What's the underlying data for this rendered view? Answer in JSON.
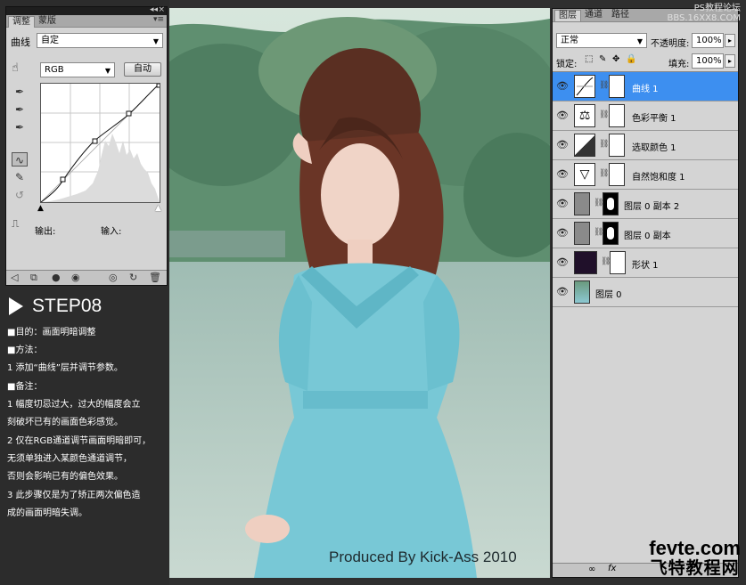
{
  "adjustments": {
    "tabs": [
      "调整",
      "蒙版"
    ],
    "preset_label": "曲线",
    "preset_value": "自定",
    "channel_value": "RGB",
    "auto_label": "自动",
    "output_label": "输出:",
    "input_label": "输入:"
  },
  "instructions": {
    "step_title": "STEP08",
    "lines": [
      "■目的：画面明暗调整",
      "■方法：",
      "1 添加“曲线”层并调节参数。",
      "■备注：",
      "1 幅度切忌过大，过大的幅度会立",
      "  刻破坏已有的画面色彩感觉。",
      "2 仅在RGB通道调节画面明暗即可，",
      "  无须单独进入某颜色通道调节，",
      "  否则会影响已有的偏色效果。",
      "3 此步骤仅是为了矫正两次偏色造",
      "  成的画面明暗失调。"
    ]
  },
  "photo": {
    "credit": "Produced By Kick-Ass 2010"
  },
  "layers_panel": {
    "tabs": [
      "图层",
      "通道",
      "路径"
    ],
    "blend_mode": "正常",
    "opacity_label": "不透明度:",
    "opacity_value": "100%",
    "lock_label": "锁定:",
    "fill_label": "填充:",
    "fill_value": "100%",
    "layers": [
      {
        "name": "曲线 1",
        "selected": true,
        "icon": "curves-icon"
      },
      {
        "name": "色彩平衡 1",
        "selected": false,
        "icon": "color-balance-icon"
      },
      {
        "name": "选取颜色 1",
        "selected": false,
        "icon": "selective-color-icon"
      },
      {
        "name": "自然饱和度 1",
        "selected": false,
        "icon": "vibrance-icon"
      },
      {
        "name": "图层 0 副本 2",
        "selected": false,
        "icon": "layer-thumb"
      },
      {
        "name": "图层 0 副本",
        "selected": false,
        "icon": "layer-thumb"
      },
      {
        "name": "形状 1",
        "selected": false,
        "icon": "shape-thumb"
      },
      {
        "name": "图层 0",
        "selected": false,
        "icon": "photo-thumb"
      }
    ]
  },
  "watermark": {
    "line1": "PS教程论坛",
    "line2": "BBS.16XX8.COM"
  },
  "brand": {
    "domain": "fevte.com",
    "cn": "飞特教程网"
  },
  "colors": {
    "selected_layer": "#3d8ff0",
    "panel_bg": "#d4d4d4",
    "dark_bg": "#2c2c2c"
  }
}
